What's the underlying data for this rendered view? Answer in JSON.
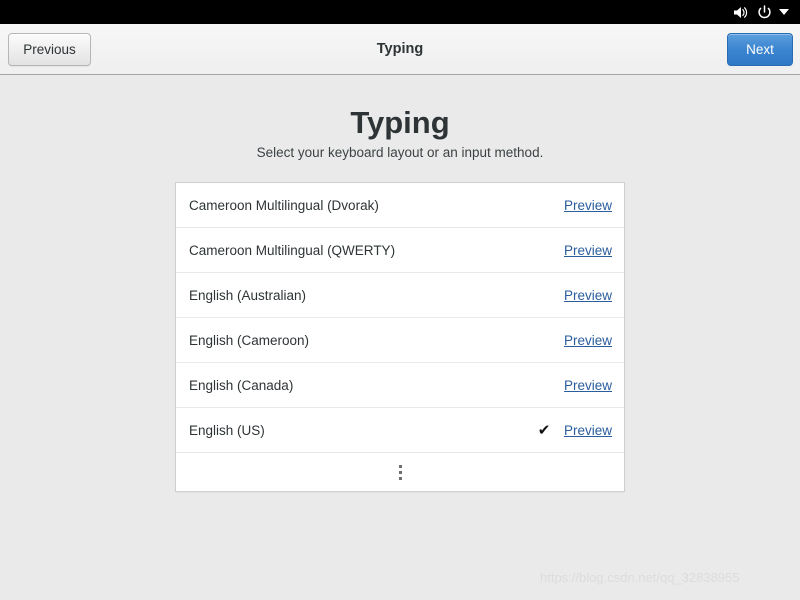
{
  "system_bar": {
    "icons": [
      {
        "name": "volume-icon",
        "label": "Volume"
      },
      {
        "name": "power-icon",
        "label": "Power"
      },
      {
        "name": "chevron-down-icon",
        "label": "System menu"
      }
    ],
    "background": "#000000"
  },
  "header": {
    "title": "Typing",
    "previous_label": "Previous",
    "next_label": "Next",
    "next_color": "#3b84d0"
  },
  "main": {
    "heading": "Typing",
    "subtitle": "Select your keyboard layout or an input method.",
    "preview_label": "Preview",
    "check_glyph": "✔",
    "more_label": "Show more layouts",
    "link_color": "#2a5d9e",
    "layouts": [
      {
        "name": "Cameroon Multilingual (Dvorak)",
        "selected": false
      },
      {
        "name": "Cameroon Multilingual (QWERTY)",
        "selected": false
      },
      {
        "name": "English (Australian)",
        "selected": false
      },
      {
        "name": "English (Cameroon)",
        "selected": false
      },
      {
        "name": "English (Canada)",
        "selected": false
      },
      {
        "name": "English (US)",
        "selected": true
      }
    ]
  },
  "watermark": {
    "text": "https://blog.csdn.net/qq_32838955"
  }
}
